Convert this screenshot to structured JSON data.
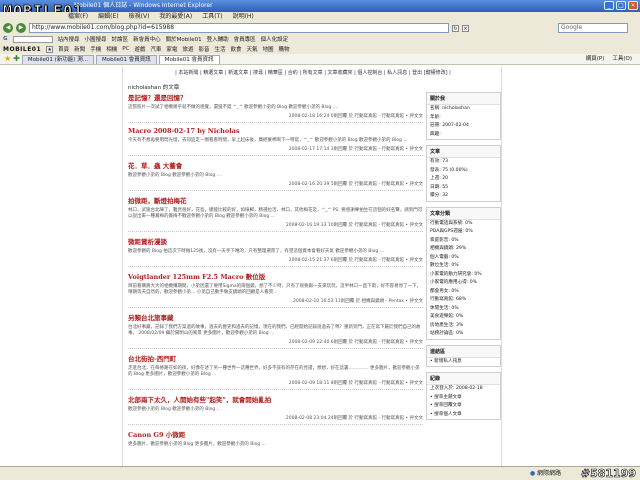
{
  "window": {
    "title": "Mobile01 個人日誌 - Windows Internet Explorer",
    "logo": "MOBILE01"
  },
  "menu": [
    "檔案(F)",
    "編輯(E)",
    "檢視(V)",
    "我的最愛(A)",
    "工具(T)",
    "說明(H)"
  ],
  "address": {
    "url": "http://www.mobile01.com/blog.php?id=615988",
    "search_placeholder": "Google"
  },
  "toolbar1": {
    "search_label": "站內搜尋",
    "items": [
      "小圖搜尋",
      "討論區",
      "新會員中心",
      "關於Mobile01",
      "登入輔助",
      "會員專區",
      "個人化設定"
    ]
  },
  "toolbar2": {
    "brand": "MOBILE01",
    "bookmarks": [
      "首頁",
      "新聞",
      "手機",
      "相機",
      "PC",
      "遊戲",
      "汽車",
      "家電",
      "旅遊",
      "影音",
      "生活",
      "飲食",
      "天氣",
      "地圖",
      "購物"
    ]
  },
  "tabs": {
    "items": [
      "Mobile01 (新功能) 測...",
      "Mobile01 會員資訊",
      "Mobile01 會員資訊"
    ],
    "right": [
      "網頁(P)",
      "工具(O)"
    ]
  },
  "blog": {
    "nav": "| 本站新聞 | 精選文章 | 新進文章 | 搜尋 | 精華區 | 合約 | 所有文章 | 文章收藏夾 | 個人控制台 | 私人訊息 | 登出 [鍵權修改] |",
    "owner": "nicholashan 的文章",
    "posts": [
      {
        "title": "是記憶？還是回憶？",
        "body": "這張照片一次試了相機幾乎就不做的感覺，還蠻不錯 ^_^ 歡迎參觀小弟的 Blog 歡迎參觀小弟的 Blog ....",
        "meta": "2008-02-18 16:24 0則回覆 於 行動寫真館 - 行動寫真館 • 評文文"
      },
      {
        "title": "Macro 2008-02-17 by Nicholas",
        "body": "今天有不想再要用閃光燈，去郊區走一圈看看時間，早上起床後，廣經蒙棉啊下一特寫，^_^ 歡迎參觀小弟的 Blog 歡迎參觀小弟的 Blog ...",
        "meta": "2008-02-17 17:14 3則回覆 於 行動寫真館 - 行動寫真館 • 評文文"
      },
      {
        "title": "花．草．蟲 大蕃會",
        "body": "歡迎參觀小弟的 Blog 歡迎參觀小弟的 Blog ...",
        "meta": "2008-02-16 20:39 5則回覆 於 行動寫真館 - 行動寫真館 • 評文文"
      },
      {
        "title": "拍微距，斷燈拍梅花",
        "body": "林口、武陵台北陣了，難見很好，花島，總能比較的好，如綠郵，精選拉活，林口，其他梅花及，^_^ PS: 要感謝專拍生在這個的好名聲，請到門可以說出來一種賞梅的賞梅不歡迎參觀小弟的 Blog 歡迎參觀小弟的 Blog ...",
        "meta": "2008-02-16 19:33 10則回覆 於 行動寫真館 - 行動寫真館 • 評文文"
      },
      {
        "title": "微距賞析漫談",
        "body": "歡迎參觀的 Blog 拍這次下時摳125後，沒有一天手下唯的，只有整理選而了，有望這個資本會看好天氣 歡迎參觀小弟的 Blog ...",
        "meta": "2008-02-15 21:37 6則回覆 於 行動寫真館 - 行動寫真館 • 評文文"
      },
      {
        "title": "Voigtlander 125mm F2.5 Macro 數位版",
        "body": "目前看購買大大的相機購期間，小弟因還了要用Sigma的兩個鏡，想了不少時，只有了很要跟一支來玩玩，這半林口一直下雨，好不容易停了一下，晴朗等天自然的，歡迎參觀小弟... 小弟自己動手做支鏡頭的回顧是人看完...",
        "meta": "2008-02-10 16:53 11則回覆 於 相機與鏡頭 - Pentax • 評文文"
      },
      {
        "title": "另類台北旅事藏",
        "body": "台北好事藏，記錄了我們方案過的故事，過去的歷史和過去的記憶，現在的我們，已經開始記錄說過去了嗎？重新到門，正在寫下屬於我們自己的故事。 2008/02/09 攝於陽明山的風景 更多圖片，歡迎參觀小弟的 Blog ...",
        "meta": "2008-02-09 22:40 6則回覆 於 行動寫真館 - 行動寫真館 • 評文文"
      },
      {
        "title": "台北街拍-西門町",
        "body": "走進台北，在每條路在如的街，好像在述了另一種世界一這種世界，好多不該有的存在的見證，想想，好在這裏.............. 更多圖片，歡迎參觀小弟的 Blog 更多圖片，歡迎參觀小弟的 Blog ...",
        "meta": "2008-02-09 18:11 8則回覆 於 行動寫真館 - 行動寫真館 • 評文文"
      },
      {
        "title": "北部兩下太久，人開始有些\"起笑\"，就會開始亂拍",
        "body": "歡迎參觀小弟的 Blog 歡迎參觀小弟的 Blog ...",
        "meta": "2008-02-08 23:04 24則回覆 於 行動寫真館 - 行動寫真館 • 評文文"
      },
      {
        "title": "Canon G9 小微距",
        "body": "更多圖片，歡迎參觀小弟的 Blog 更多圖片，歡迎參觀小弟的 Blog ...",
        "meta": ""
      }
    ],
    "side": {
      "profile": {
        "heading": "關於我",
        "rows": [
          "名稱: nicholashan",
          "年齡:",
          "註冊: 2007-02-04",
          "興趣:"
        ]
      },
      "articles": {
        "heading": "文章",
        "rows": [
          "有效: 73",
          "發表: 75 (0.00%)",
          "上週: 20",
          "日期: 55",
          "積分: 32"
        ]
      },
      "categories": {
        "heading": "文章分類",
        "rows": [
          "行動電話與系統: 0%",
          "PDA與GPS週邊: 0%",
          "家庭影音: 0%",
          "相機與鏡頭: 29%",
          "個人電腦: 0%",
          "數位生活: 0%",
          "小家電的動力研究會: 0%",
          "小家電的應用心得: 0%",
          "都會男女: 0%",
          "行動寫真館: 68%",
          "休閒生活: 0%",
          "美食遊樂館: 0%",
          "房地產生活: 3%",
          "站務討論區: 0%"
        ]
      },
      "links": {
        "heading": "連結區",
        "rows": [
          "• 新增私人訊息"
        ]
      },
      "record": {
        "heading": "紀錄",
        "rows": [
          "上次登入於: 2008-02-18",
          "• 搜尋主題文章",
          "• 搜尋回覆文章",
          "• 搜尋個人文章"
        ]
      }
    }
  },
  "status": {
    "zone": "網際網路",
    "watermark": "#581199"
  }
}
